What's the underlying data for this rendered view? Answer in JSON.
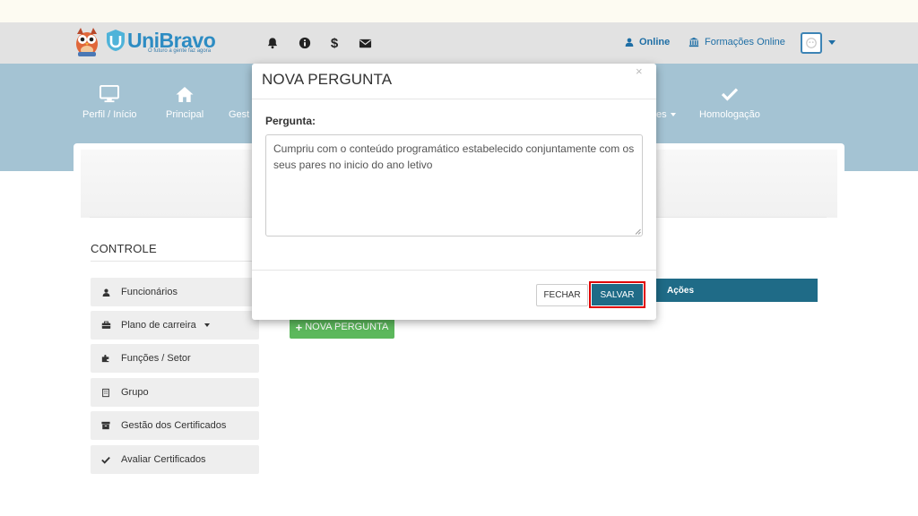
{
  "brand": {
    "name": "UniBravo",
    "tagline": "O futuro a gente faz agora",
    "colors": {
      "primary": "#2d8cc3",
      "dark_teal": "#1f6b87",
      "band": "#a4c3d3",
      "success": "#5cb85c",
      "highlight": "#e00000"
    }
  },
  "header": {
    "icons": [
      "bell-icon",
      "info-icon",
      "dollar-icon",
      "envelope-icon"
    ],
    "online_label": "Online",
    "formacoes_label": "Formações Online",
    "avatar_icon": "user-avatar-icon"
  },
  "nav": {
    "items": [
      {
        "label": "Perfil / Início",
        "icon": "monitor-icon"
      },
      {
        "label": "Principal",
        "icon": "home-icon"
      },
      {
        "label": "Gest",
        "icon": "none"
      },
      {
        "label": "es",
        "icon": "none",
        "has_caret": true
      },
      {
        "label": "Homologação",
        "icon": "check-icon"
      }
    ]
  },
  "sidebar": {
    "title": "CONTROLE",
    "items": [
      {
        "label": "Funcionários",
        "icon": "user-icon"
      },
      {
        "label": "Plano de carreira",
        "icon": "briefcase-icon",
        "has_caret": true
      },
      {
        "label": "Funções / Setor",
        "icon": "puzzle-icon"
      },
      {
        "label": "Grupo",
        "icon": "building-icon"
      },
      {
        "label": "Gestão dos Certificados",
        "icon": "archive-icon"
      },
      {
        "label": "Avaliar Certificados",
        "icon": "check-icon"
      }
    ]
  },
  "table": {
    "actions_header": "Ações"
  },
  "content": {
    "new_question_button": "NOVA PERGUNTA"
  },
  "modal": {
    "title": "NOVA PERGUNTA",
    "close_symbol": "×",
    "field_label": "Pergunta:",
    "field_value": "Cumpriu com o conteúdo programático estabelecido conjuntamente com os seus pares no inicio do ano letivo",
    "fechar_label": "FECHAR",
    "salvar_label": "SALVAR"
  }
}
